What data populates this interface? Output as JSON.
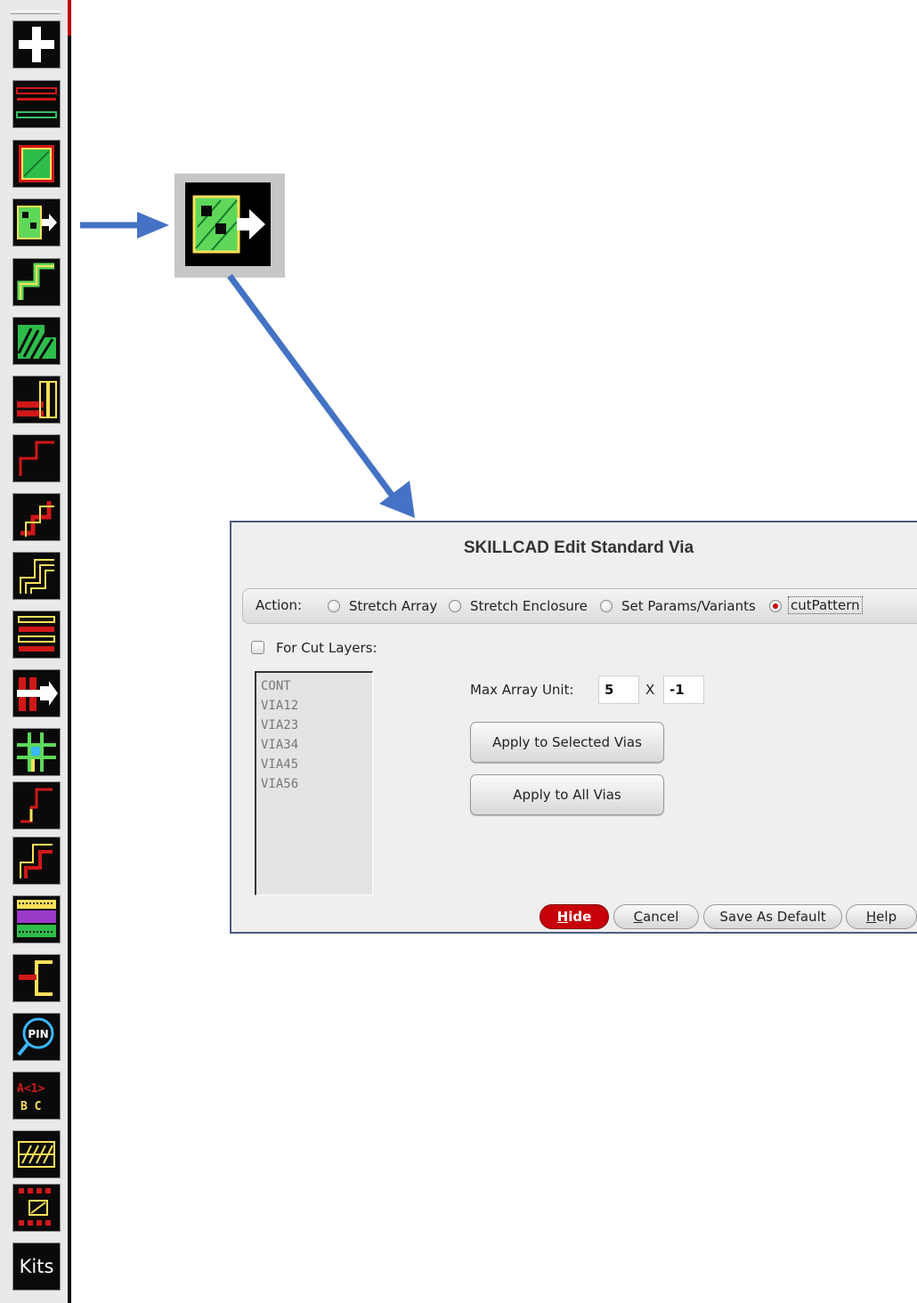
{
  "toolbar": {
    "buttons": [
      {
        "name": "add-tool-icon"
      },
      {
        "name": "wire-lines-icon"
      },
      {
        "name": "green-rect-icon"
      },
      {
        "name": "edit-via-icon"
      },
      {
        "name": "step-path-icon"
      },
      {
        "name": "hatched-shape-icon"
      },
      {
        "name": "red-yellow-bars-icon"
      },
      {
        "name": "red-step-icon"
      },
      {
        "name": "double-step-icon"
      },
      {
        "name": "yellow-step-icon"
      },
      {
        "name": "multi-bar-icon"
      },
      {
        "name": "red-via-arrow-icon"
      },
      {
        "name": "grid-cross-icon"
      },
      {
        "name": "yellow-step-small-icon"
      },
      {
        "name": "red-step-small-icon"
      },
      {
        "name": "pattern-fill-icon"
      },
      {
        "name": "bracket-icon"
      },
      {
        "name": "pin-magnifier-icon"
      },
      {
        "name": "bus-label-icon",
        "text_top": "A<1>",
        "text_bottom": "B C"
      },
      {
        "name": "yellow-pattern-icon"
      },
      {
        "name": "red-array-icon"
      }
    ],
    "kits_label": "Kits"
  },
  "dialog": {
    "title": "SKILLCAD Edit Standard Via",
    "action_label": "Action:",
    "actions": [
      {
        "label": "Stretch Array",
        "selected": false
      },
      {
        "label": "Stretch Enclosure",
        "selected": false
      },
      {
        "label": "Set Params/Variants",
        "selected": false
      },
      {
        "label": "cutPattern",
        "selected": true
      }
    ],
    "cut_layers_label": "For Cut Layers:",
    "cut_layers_checked": false,
    "layers": [
      "CONT",
      "VIA12",
      "VIA23",
      "VIA34",
      "VIA45",
      "VIA56"
    ],
    "max_array_label": "Max Array Unit:",
    "max_array_x": "5",
    "x_sep": "X",
    "max_array_y": "-1",
    "apply_selected": "Apply to Selected Vias",
    "apply_all": "Apply to All Vias",
    "footer": {
      "hide": {
        "first": "H",
        "rest": "ide"
      },
      "cancel": {
        "first": "C",
        "rest": "ancel"
      },
      "save_default": "Save As Default",
      "help": {
        "first": "H",
        "rest": "elp"
      }
    }
  },
  "colors": {
    "accent_red": "#c8000a",
    "arrow_blue": "#4472c4"
  }
}
